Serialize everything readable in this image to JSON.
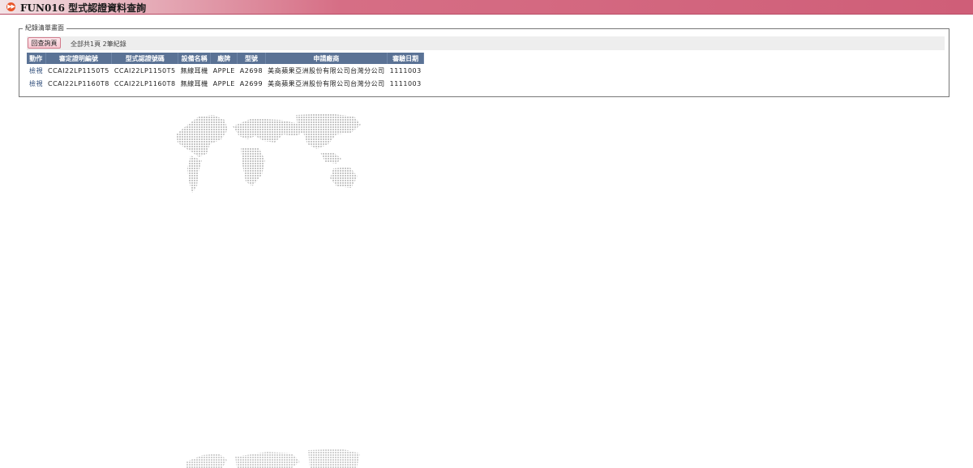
{
  "header": {
    "title": "FUN016 型式認證資料查詢",
    "icon": "fast-forward-icon",
    "gradient_color": "#cf5e78"
  },
  "records": {
    "legend": "紀錄清單畫面",
    "back_button": "回查詢頁",
    "page_info": "全部共1頁 2筆紀錄",
    "columns": [
      "動作",
      "審定證明編號",
      "型式認證號碼",
      "設備名稱",
      "廠牌",
      "型號",
      "申請廠商",
      "審驗日期"
    ],
    "rows": [
      {
        "action": "檢視",
        "approval_no": "CCAI22LP1150T5",
        "cert_no": "CCAI22LP1150T5",
        "device": "無線耳機",
        "brand": "APPLE",
        "model": "A2698",
        "applicant": "美商蘋果亞洲股份有限公司台灣分公司",
        "date": "1111003"
      },
      {
        "action": "檢視",
        "approval_no": "CCAI22LP1160T8",
        "cert_no": "CCAI22LP1160T8",
        "device": "無線耳機",
        "brand": "APPLE",
        "model": "A2699",
        "applicant": "美商蘋果亞洲股份有限公司台灣分公司",
        "date": "1111003"
      }
    ],
    "header_color": "#5a7295"
  },
  "background": {
    "watermark": "world-map-dotted-watermark"
  }
}
